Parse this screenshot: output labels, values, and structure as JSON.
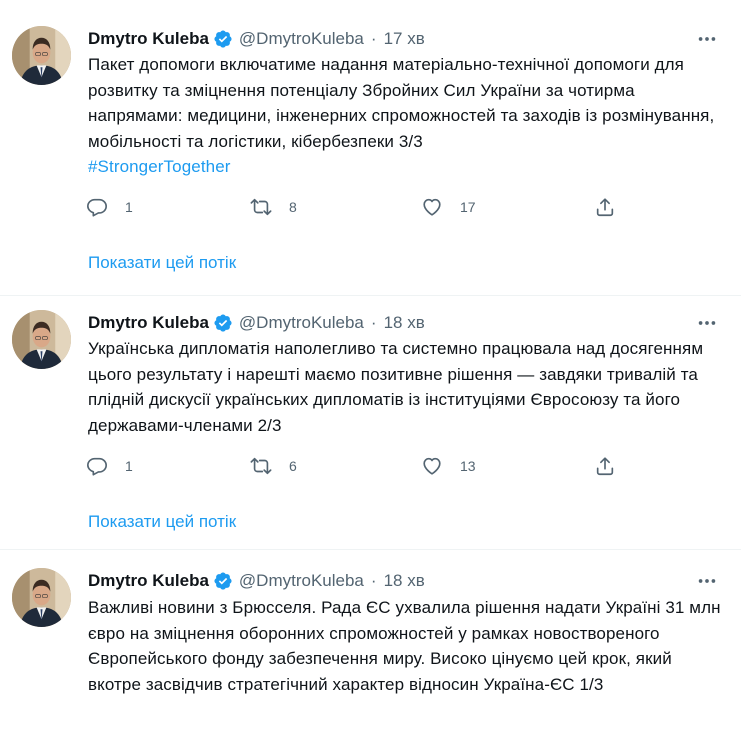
{
  "tweets": [
    {
      "author_name": "Dmytro Kuleba",
      "handle": "@DmytroKuleba",
      "separator": "·",
      "time": "17 хв",
      "text": "Пакет допомоги включатиме надання матеріально-технічної допомоги для розвитку та зміцнення потенціалу Збройних Сил України за чотирма напрямами: медицини, інженерних спроможностей та заходів із розмінування, мобільності та логістики, кібербезпеки 3/3",
      "hashtag": "#StrongerTogether",
      "replies": "1",
      "retweets": "8",
      "likes": "17",
      "thread_link": "Показати цей потік"
    },
    {
      "author_name": "Dmytro Kuleba",
      "handle": "@DmytroKuleba",
      "separator": "·",
      "time": "18 хв",
      "text": "Українська дипломатія наполегливо та системно працювала над досягенням цього результату і нарешті маємо позитивне рішення — завдяки тривалій та плідній дискусії українських дипломатів із інституціями Євросоюзу та його державами-членами 2/3",
      "replies": "1",
      "retweets": "6",
      "likes": "13",
      "thread_link": "Показати цей потік"
    },
    {
      "author_name": "Dmytro Kuleba",
      "handle": "@DmytroKuleba",
      "separator": "·",
      "time": "18 хв",
      "text": "Важливі новини з Брюсселя. Рада ЄС ухвалила рішення надати Україні 31 млн євро на зміцнення оборонних спроможностей у рамках новоствореного Європейського фонду забезпечення миру. Високо цінуємо цей крок, який вкотре засвідчив стратегічний характер відносин Україна-ЄС 1/3"
    }
  ],
  "icons": {
    "verified": "verified-badge-icon",
    "more": "more-options-icon",
    "reply": "reply-icon",
    "retweet": "retweet-icon",
    "like": "like-icon",
    "share": "share-icon"
  },
  "colors": {
    "accent": "#1d9bf0",
    "text": "#0f1419",
    "secondary": "#536471",
    "border": "#eff3f4"
  }
}
